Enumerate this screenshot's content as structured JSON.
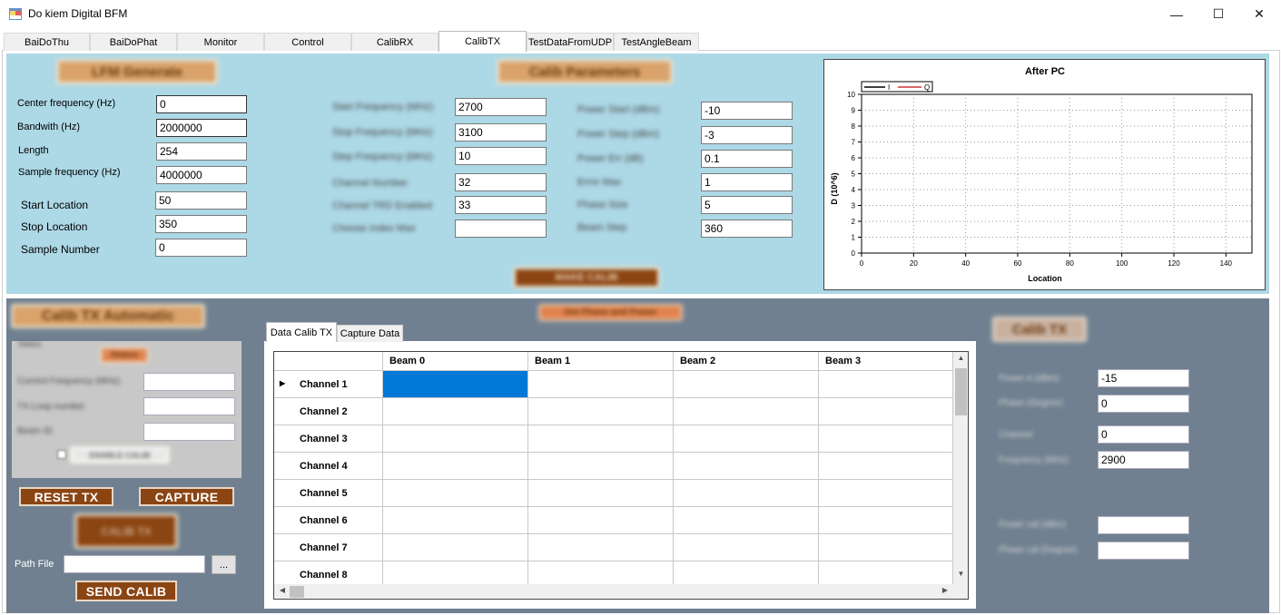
{
  "window": {
    "title": "Do kiem Digital BFM",
    "controls": {
      "minimize": "—",
      "maximize": "☐",
      "close": "✕"
    }
  },
  "tabs": [
    "BaiDoThu",
    "BaiDoPhat",
    "Monitor",
    "Control",
    "CalibRX",
    "CalibTX",
    "TestDataFromUDP",
    "TestAngleBeam"
  ],
  "active_tab": "CalibTX",
  "lfm": {
    "header": "LFM Generate",
    "fields": [
      {
        "label": "Center frequency (Hz)",
        "value": "0"
      },
      {
        "label": "Bandwith (Hz)",
        "value": "2000000"
      },
      {
        "label": "Length",
        "value": "254"
      },
      {
        "label": "Sample frequency (Hz)",
        "value": "4000000"
      },
      {
        "label": "Start Location",
        "value": "50"
      },
      {
        "label": "Stop Location",
        "value": "350"
      },
      {
        "label": "Sample Number",
        "value": "0"
      }
    ]
  },
  "calib_params": {
    "header": "Calib Parameters",
    "left": [
      {
        "label": "Start Frequency (MHz)",
        "value": "2700"
      },
      {
        "label": "Stop Frequency (MHz)",
        "value": "3100"
      },
      {
        "label": "Step Frequency (MHz)",
        "value": "10"
      },
      {
        "label": "Channel Number",
        "value": "32"
      },
      {
        "label": "Channel TRD Enabled",
        "value": "33"
      },
      {
        "label": "Choose Index Max",
        "value": ""
      }
    ],
    "right": [
      {
        "label": "Power Start (dBm)",
        "value": "-10"
      },
      {
        "label": "Power Step (dBm)",
        "value": "-3"
      },
      {
        "label": "Power Err (dB)",
        "value": "0.1"
      },
      {
        "label": "Error Max",
        "value": "1"
      },
      {
        "label": "Phase Size",
        "value": "5"
      },
      {
        "label": "Beam Step",
        "value": "360"
      }
    ],
    "button": "MAKE CALIB"
  },
  "chart": {
    "title": "After PC",
    "legend": [
      "I",
      "Q"
    ],
    "colors": {
      "I": "#000000",
      "Q": "#cc3333"
    }
  },
  "chart_data": {
    "type": "line",
    "title": "After PC",
    "xlabel": "Location",
    "ylabel": "D (10^6)",
    "xlim": [
      0,
      150
    ],
    "ylim": [
      0,
      10
    ],
    "xticks": [
      0,
      20,
      40,
      60,
      80,
      100,
      120,
      140
    ],
    "yticks": [
      0,
      1,
      2,
      3,
      4,
      5,
      6,
      7,
      8,
      9,
      10
    ],
    "grid": true,
    "legend_position": "top-left",
    "series": [
      {
        "name": "I",
        "x": [],
        "y": []
      },
      {
        "name": "Q",
        "x": [],
        "y": []
      }
    ]
  },
  "calib_auto": {
    "header": "Calib TX Automatic",
    "group_title": "Status",
    "status_button": "Status",
    "fields": [
      {
        "label": "Current Frequency (MHz)",
        "value": ""
      },
      {
        "label": "TX Loop number",
        "value": ""
      },
      {
        "label": "Beam ID",
        "value": ""
      }
    ],
    "checkbox_label": "ENABLE CALIB",
    "reset_button": "RESET TX",
    "capture_button": "CAPTURE",
    "calib_button": "CALIB TX",
    "path_label": "Path File",
    "path_value": "",
    "browse_button": "...",
    "send_button": "SEND CALIB"
  },
  "center": {
    "get_button": "Get Phase and Power",
    "subtabs": [
      "Data Calib TX",
      "Capture Data"
    ],
    "active_subtab": "Data Calib TX",
    "grid": {
      "columns": [
        "Beam 0",
        "Beam 1",
        "Beam 2",
        "Beam 3"
      ],
      "rows": [
        "Channel 1",
        "Channel 2",
        "Channel 3",
        "Channel 4",
        "Channel 5",
        "Channel 6",
        "Channel 7",
        "Channel 8"
      ],
      "selected_row_marker": "▶"
    },
    "scroll": {
      "up": "▲",
      "down": "▼",
      "left": "◀",
      "right": "▶"
    }
  },
  "calib_tx": {
    "header": "Calib TX",
    "fields": [
      {
        "label": "Power A (dBm)",
        "value": "-15"
      },
      {
        "label": "Phase (Degree)",
        "value": "0"
      },
      {
        "label": "Channel",
        "value": "0"
      },
      {
        "label": "Frequency (MHz)",
        "value": "2900"
      },
      {
        "label": "Power cal (dBm)",
        "value": ""
      },
      {
        "label": "Phase cal (Degree)",
        "value": ""
      }
    ]
  }
}
